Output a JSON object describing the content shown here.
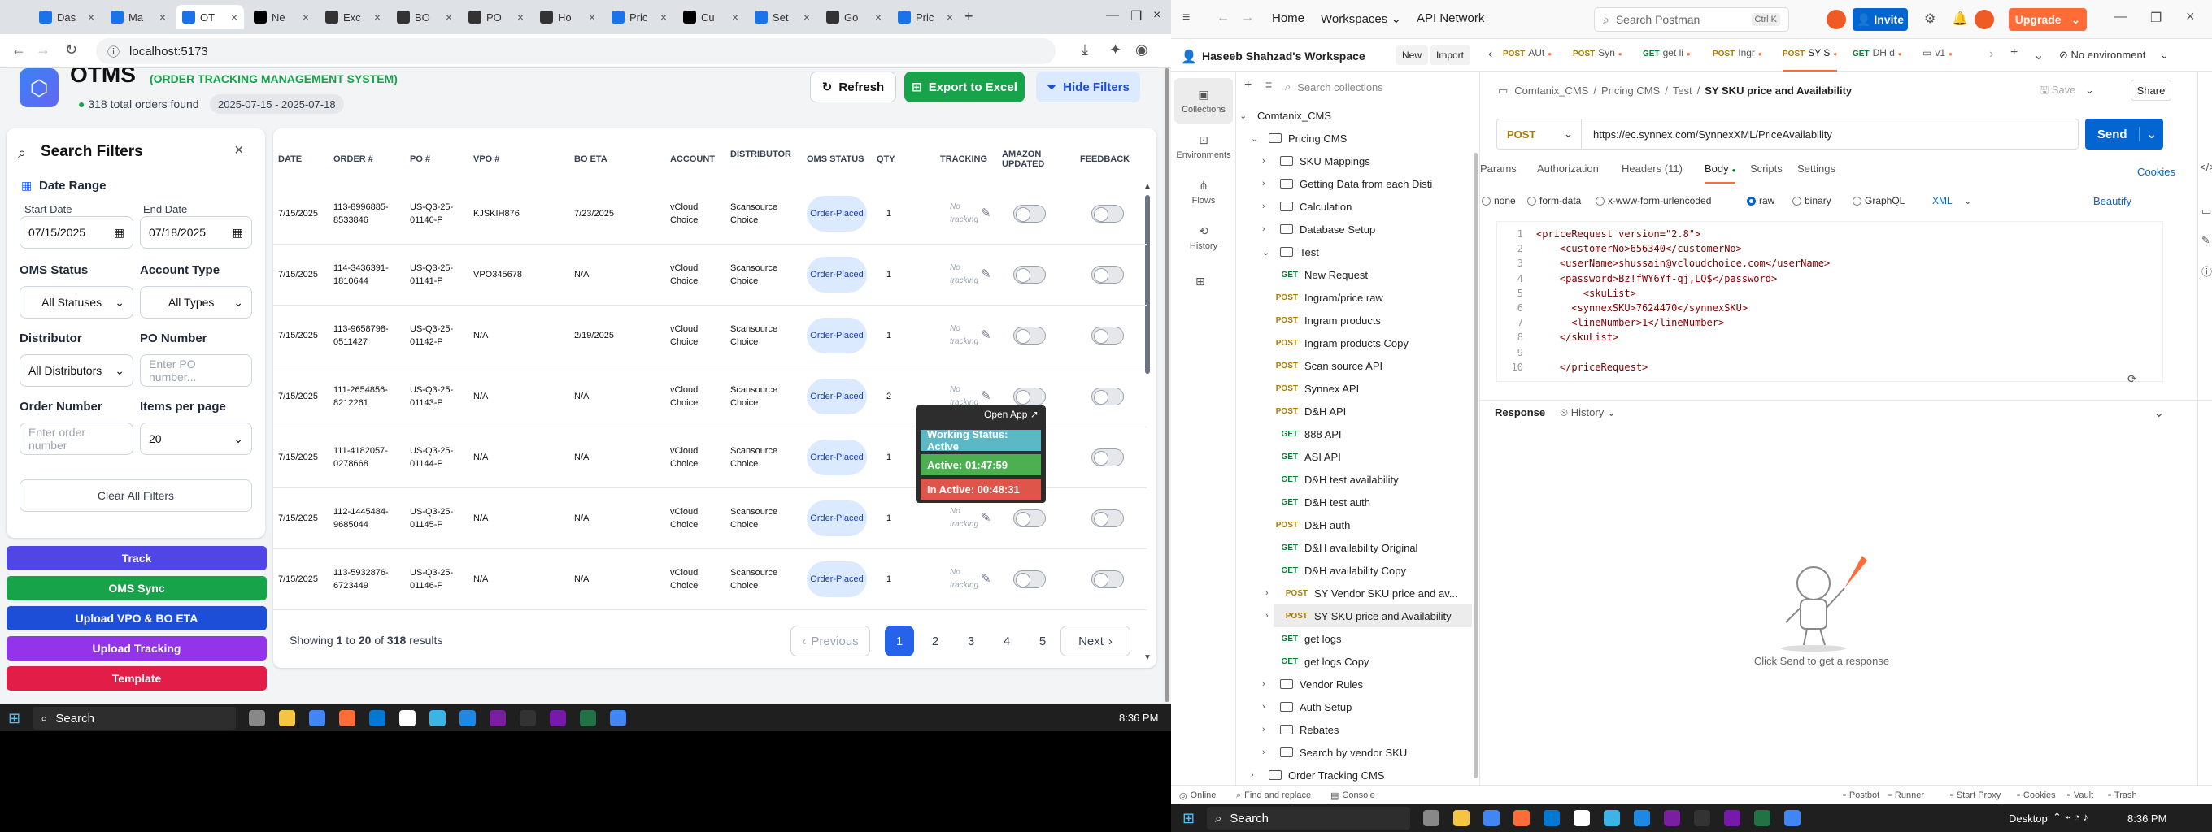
{
  "chrome": {
    "tabs": [
      {
        "label": "Das",
        "color": "#1a73e8"
      },
      {
        "label": "Ma",
        "color": "#1a73e8"
      },
      {
        "label": "OT",
        "color": "#1a73e8",
        "active": true
      },
      {
        "label": "Ne",
        "color": "#000000"
      },
      {
        "label": "Exc",
        "color": "#333333"
      },
      {
        "label": "BO",
        "color": "#333333"
      },
      {
        "label": "PO",
        "color": "#333333"
      },
      {
        "label": "Ho",
        "color": "#333333"
      },
      {
        "label": "Pric",
        "color": "#1a73e8"
      },
      {
        "label": "Cu",
        "color": "#000000"
      },
      {
        "label": "Set",
        "color": "#1a73e8"
      },
      {
        "label": "Go",
        "color": "#333333"
      },
      {
        "label": "Pric",
        "color": "#1a73e8"
      }
    ],
    "url": "localhost:5173"
  },
  "oms": {
    "title": "OTMS",
    "subtitle": "(ORDER TRACKING MANAGEMENT SYSTEM)",
    "total": "318 total orders found",
    "daterange": "2025-07-15 - 2025-07-18",
    "refresh": "Refresh",
    "export": "Export to Excel",
    "hide": "Hide Filters",
    "filters": {
      "title": "Search Filters",
      "date_range": "Date Range",
      "start_label": "Start Date",
      "start_value": "07/15/2025",
      "end_label": "End Date",
      "end_value": "07/18/2025",
      "oms_status": "OMS Status",
      "oms_value": "All Statuses",
      "account_type": "Account Type",
      "account_value": "All Types",
      "distributor": "Distributor",
      "distributor_value": "All Distributors",
      "po_number": "PO Number",
      "po_placeholder": "Enter PO number...",
      "order_number": "Order Number",
      "order_placeholder": "Enter order number",
      "items_per_page": "Items per page",
      "items_value": "20",
      "clear": "Clear All Filters"
    },
    "side_buttons": [
      {
        "label": "Track",
        "color": "#4f46e5"
      },
      {
        "label": "OMS Sync",
        "color": "#16a34a"
      },
      {
        "label": "Upload VPO & BO ETA",
        "color": "#1d4ed8"
      },
      {
        "label": "Upload Tracking",
        "color": "#9333ea"
      },
      {
        "label": "Template",
        "color": "#e11d48"
      }
    ],
    "columns": [
      "Date",
      "Order #",
      "PO #",
      "VPO #",
      "BO ETA",
      "Account",
      "Distributor",
      "OMS Status",
      "QTY",
      "Tracking",
      "Amazon Updated",
      "Feedback"
    ],
    "rows": [
      {
        "date": "7/15/2025",
        "order": "113-8996885-8533846",
        "po": "US-Q3-25-01140-P",
        "vpo": "KJSKIH876",
        "eta": "7/23/2025",
        "account": "vCloud Choice",
        "dist": "Scansource Choice",
        "status": "Order-Placed",
        "qty": "1",
        "tracking": "No tracking"
      },
      {
        "date": "7/15/2025",
        "order": "114-3436391-1810644",
        "po": "US-Q3-25-01141-P",
        "vpo": "VPO345678",
        "eta": "N/A",
        "account": "vCloud Choice",
        "dist": "Scansource Choice",
        "status": "Order-Placed",
        "qty": "1",
        "tracking": "No tracking"
      },
      {
        "date": "7/15/2025",
        "order": "113-9658798-0511427",
        "po": "US-Q3-25-01142-P",
        "vpo": "N/A",
        "eta": "2/19/2025",
        "account": "vCloud Choice",
        "dist": "Scansource Choice",
        "status": "Order-Placed",
        "qty": "1",
        "tracking": "No tracking"
      },
      {
        "date": "7/15/2025",
        "order": "111-2654856-8212261",
        "po": "US-Q3-25-01143-P",
        "vpo": "N/A",
        "eta": "N/A",
        "account": "vCloud Choice",
        "dist": "Scansource Choice",
        "status": "Order-Placed",
        "qty": "2",
        "tracking": "No tracking"
      },
      {
        "date": "7/15/2025",
        "order": "111-4182057-0278668",
        "po": "US-Q3-25-01144-P",
        "vpo": "N/A",
        "eta": "N/A",
        "account": "vCloud Choice",
        "dist": "Scansource Choice",
        "status": "Order-Placed",
        "qty": "1",
        "tracking": "No tracking"
      },
      {
        "date": "7/15/2025",
        "order": "112-1445484-9685044",
        "po": "US-Q3-25-01145-P",
        "vpo": "N/A",
        "eta": "N/A",
        "account": "vCloud Choice",
        "dist": "Scansource Choice",
        "status": "Order-Placed",
        "qty": "1",
        "tracking": "No tracking"
      },
      {
        "date": "7/15/2025",
        "order": "113-5932876-6723449",
        "po": "US-Q3-25-01146-P",
        "vpo": "N/A",
        "eta": "N/A",
        "account": "vCloud Choice",
        "dist": "Scansource Choice",
        "status": "Order-Placed",
        "qty": "1",
        "tracking": "No tracking"
      }
    ],
    "pagination": {
      "showing": "Showing",
      "from": "1",
      "to_word": "to",
      "to": "20",
      "of_word": "of",
      "total": "318",
      "results": "results",
      "previous": "Previous",
      "pages": [
        "1",
        "2",
        "3",
        "4",
        "5"
      ],
      "next": "Next"
    },
    "popup": {
      "open": "Open App ↗",
      "working": "Working Status: Active",
      "active": "Active: 01:47:59",
      "inactive": "In Active: 00:48:31"
    }
  },
  "taskbar_left": {
    "search": "Search",
    "time": "8:36 PM"
  },
  "taskbar_right": {
    "search": "Search",
    "desktop": "Desktop",
    "time": "8:36 PM"
  },
  "postman": {
    "nav": {
      "home": "Home",
      "workspaces": "Workspaces",
      "api_network": "API Network",
      "search": "Search Postman",
      "shortcut": "Ctrl K",
      "invite": "Invite",
      "upgrade": "Upgrade"
    },
    "workspace": "Haseeb Shahzad's Workspace",
    "new": "New",
    "import": "Import",
    "rail": [
      "Collections",
      "Environments",
      "Flows",
      "History"
    ],
    "search_collections": "Search collections",
    "tree": [
      {
        "d": 0,
        "type": "folder",
        "open": true,
        "label": "Comtanix_CMS",
        "nofold": true
      },
      {
        "d": 1,
        "type": "folder",
        "open": true,
        "label": "Pricing CMS"
      },
      {
        "d": 2,
        "type": "folder",
        "label": "SKU Mappings"
      },
      {
        "d": 2,
        "type": "folder",
        "label": "Getting Data from each Disti"
      },
      {
        "d": 2,
        "type": "folder",
        "label": "Calculation"
      },
      {
        "d": 2,
        "type": "folder",
        "label": "Database Setup"
      },
      {
        "d": 2,
        "type": "folder",
        "open": true,
        "label": "Test"
      },
      {
        "d": 3,
        "m": "GET",
        "label": "New Request"
      },
      {
        "d": 3,
        "m": "POST",
        "label": "Ingram/price raw"
      },
      {
        "d": 3,
        "m": "POST",
        "label": "Ingram products"
      },
      {
        "d": 3,
        "m": "POST",
        "label": "Ingram products Copy"
      },
      {
        "d": 3,
        "m": "POST",
        "label": "Scan source API"
      },
      {
        "d": 3,
        "m": "POST",
        "label": "Synnex API"
      },
      {
        "d": 3,
        "m": "POST",
        "label": "D&H API"
      },
      {
        "d": 3,
        "m": "GET",
        "label": "888 API"
      },
      {
        "d": 3,
        "m": "GET",
        "label": "ASI API"
      },
      {
        "d": 3,
        "m": "GET",
        "label": "D&H test availability"
      },
      {
        "d": 3,
        "m": "GET",
        "label": "D&H test auth"
      },
      {
        "d": 3,
        "m": "POST",
        "label": "D&H auth"
      },
      {
        "d": 3,
        "m": "GET",
        "label": "D&H availability Original"
      },
      {
        "d": 3,
        "m": "GET",
        "label": "D&H availability Copy"
      },
      {
        "d": 3,
        "m": "POST",
        "label": "SY Vendor SKU price and av...",
        "chev": true
      },
      {
        "d": 3,
        "m": "POST",
        "label": "SY SKU price and Availability",
        "chev": true,
        "sel": true
      },
      {
        "d": 3,
        "m": "GET",
        "label": "get logs"
      },
      {
        "d": 3,
        "m": "GET",
        "label": "get logs Copy"
      },
      {
        "d": 2,
        "type": "folder",
        "label": "Vendor Rules"
      },
      {
        "d": 2,
        "type": "folder",
        "label": "Auth Setup"
      },
      {
        "d": 2,
        "type": "folder",
        "label": "Rebates"
      },
      {
        "d": 2,
        "type": "folder",
        "label": "Search by vendor SKU"
      },
      {
        "d": 1,
        "type": "folder",
        "label": "Order Tracking CMS"
      }
    ],
    "req_tabs": [
      {
        "m": "POST",
        "label": "AUt"
      },
      {
        "m": "POST",
        "label": "Syn"
      },
      {
        "m": "GET",
        "label": "get li"
      },
      {
        "m": "POST",
        "label": "Ingr"
      },
      {
        "m": "POST",
        "label": "SY S",
        "active": true
      },
      {
        "m": "GET",
        "label": "DH d"
      },
      {
        "m": "",
        "label": "v1"
      }
    ],
    "no_env": "No environment",
    "breadcrumb": [
      "Comtanix_CMS",
      "Pricing CMS",
      "Test",
      "SY SKU price and Availability"
    ],
    "save": "Save",
    "share": "Share",
    "method": "POST",
    "url": "https://ec.synnex.com/SynnexXML/PriceAvailability",
    "send": "Send",
    "tabs": [
      "Params",
      "Authorization",
      "Headers (11)",
      "Body",
      "Scripts",
      "Settings"
    ],
    "cookies": "Cookies",
    "body_types": [
      "none",
      "form-data",
      "x-www-form-urlencoded",
      "raw",
      "binary",
      "GraphQL"
    ],
    "xml": "XML",
    "beautify": "Beautify",
    "code": [
      "<priceRequest version=\"2.8\">",
      "    <customerNo>656340</customerNo>",
      "    <userName>shussain@vcloudchoice.com</userName>",
      "    <password>Bz!fWY6Yf-qj,LQ$</password>",
      "        <skuList>",
      "      <synnexSKU>7624470</synnexSKU>",
      "      <lineNumber>1</lineNumber>",
      "    </skuList>",
      "",
      "    </priceRequest>"
    ],
    "response": "Response",
    "history": "History",
    "click_send": "Click Send to get a response",
    "footer": [
      "Online",
      "Find and replace",
      "Console"
    ],
    "footer_right": [
      "Postbot",
      "Runner",
      "Start Proxy",
      "Cookies",
      "Vault",
      "Trash"
    ]
  }
}
